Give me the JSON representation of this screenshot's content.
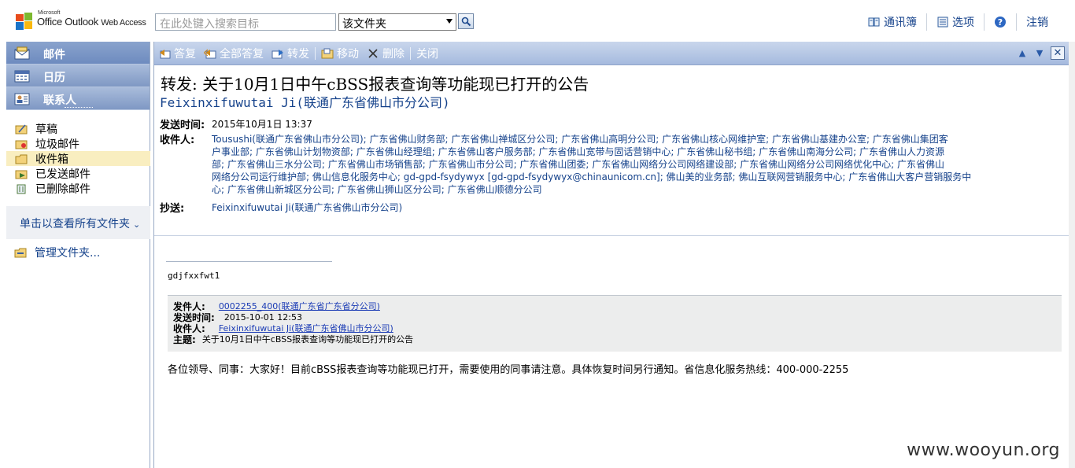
{
  "app": {
    "ms_label": "Microsoft",
    "brand_main": "Office Outlook",
    "brand_sub": "Web Access"
  },
  "search": {
    "placeholder": "在此处键入搜索目标",
    "scope": "该文件夹"
  },
  "toplinks": {
    "contacts_book": "通讯簿",
    "options": "选项",
    "signout": "注销"
  },
  "nav": {
    "mail": "邮件",
    "calendar": "日历",
    "contacts": "联系人"
  },
  "folders": [
    {
      "label": "草稿"
    },
    {
      "label": "垃圾邮件"
    },
    {
      "label": "收件箱"
    },
    {
      "label": "已发送邮件"
    },
    {
      "label": "已删除邮件"
    }
  ],
  "view_all": "单击以查看所有文件夹",
  "manage_folders": "管理文件夹...",
  "toolbar": {
    "reply": "答复",
    "reply_all": "全部答复",
    "forward": "转发",
    "move": "移动",
    "delete": "删除",
    "close": "关闭"
  },
  "message": {
    "subject": "转发: 关于10月1日中午cBSS报表查询等功能现已打开的公告",
    "from": "Feixinxifuwutai Ji(联通广东省佛山市分公司)",
    "sent_label": "发送时间:",
    "sent_value": "2015年10月1日 13:37",
    "to_label": "收件人:",
    "to_lines": [
      "Tousushi(联通广东省佛山市分公司); 广东省佛山财务部; 广东省佛山禅城区分公司; 广东省佛山高明分公司; 广东省佛山核心网维护室; 广东省佛山基建办公室; 广东省佛山集团客",
      "户事业部; 广东省佛山计划物资部; 广东省佛山经理组; 广东省佛山客户服务部; 广东省佛山宽带与固话营销中心; 广东省佛山秘书组; 广东省佛山南海分公司; 广东省佛山人力资源",
      "部; 广东省佛山三水分公司; 广东省佛山市场销售部; 广东省佛山市分公司; 广东省佛山团委; 广东省佛山网络分公司网络建设部; 广东省佛山网络分公司网络优化中心; 广东省佛山",
      "网络分公司运行维护部; 佛山信息化服务中心; gd-gpd-fsydywyx [gd-gpd-fsydywyx@chinaunicom.cn]; 佛山美的业务部; 佛山互联网营销服务中心; 广东省佛山大客户营销服务中",
      "心; 广东省佛山新城区分公司; 广东省佛山狮山区分公司; 广东省佛山顺德分公司"
    ],
    "cc_label": "抄送:",
    "cc_value": "Feixinxifuwutai Ji(联通广东省佛山市分公司)"
  },
  "body": {
    "signature": "gdjfxxfwt1",
    "quote": {
      "from_label": "发件人:",
      "from_value": "0002255_400(联通广东省广东省分公司)",
      "sent_label": "发送时间:",
      "sent_value": "2015-10-01  12:53",
      "to_label": "收件人:",
      "to_value": "Feixinxifuwutai Ji(联通广东省佛山市分公司)",
      "subject_label": "主题:",
      "subject_value": "关于10月1日中午cBSS报表查询等功能现已打开的公告"
    },
    "text": "各位领导、同事：大家好！目前cBSS报表查询等功能现已打开，需要使用的同事请注意。具体恢复时间另行通知。省信息化服务热线：400-000-2255"
  },
  "watermark": "www.wooyun.org"
}
